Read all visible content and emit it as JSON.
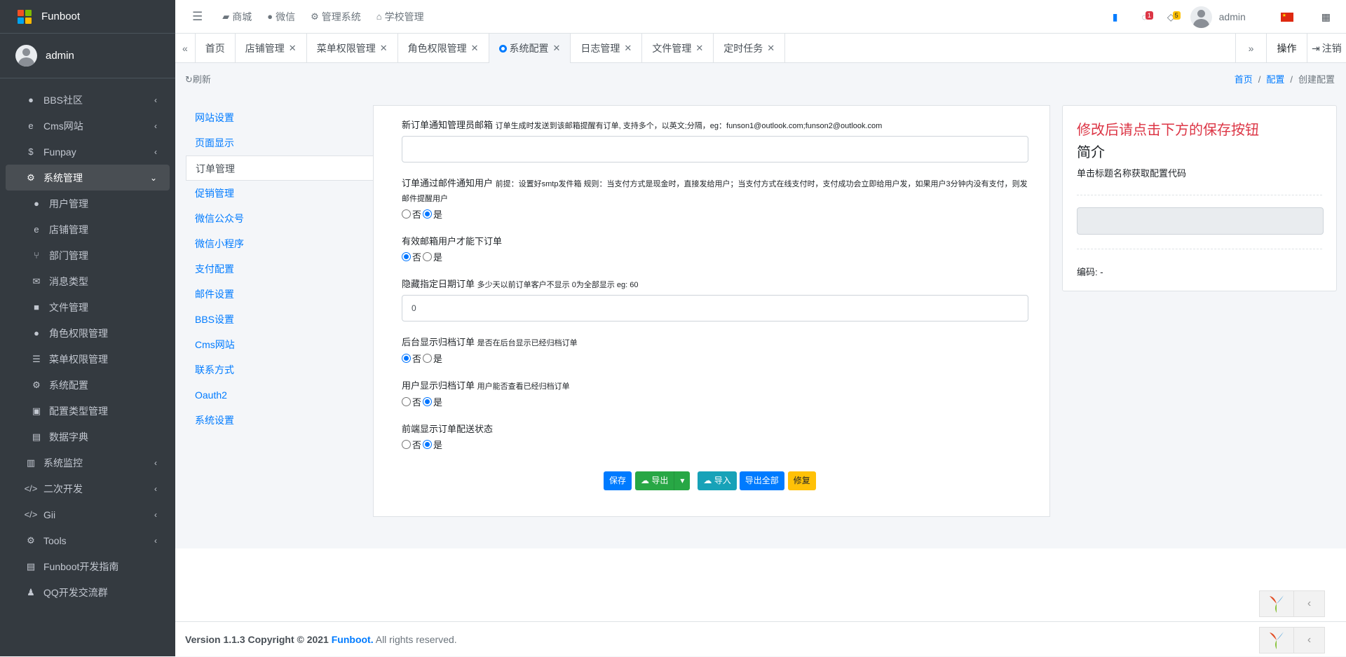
{
  "brand": {
    "name": "Funboot"
  },
  "user": {
    "name": "admin"
  },
  "sidebar": {
    "items": [
      {
        "label": "BBS社区",
        "icon": "comment-icon",
        "chev": "‹"
      },
      {
        "label": "Cms网站",
        "icon": "ie-icon",
        "chev": "‹"
      },
      {
        "label": "Funpay",
        "icon": "dollar-icon",
        "chev": "‹"
      },
      {
        "label": "系统管理",
        "icon": "cogs-icon",
        "chev": "⌄"
      },
      {
        "label": "用户管理",
        "icon": "user-icon"
      },
      {
        "label": "店铺管理",
        "icon": "ie-icon"
      },
      {
        "label": "部门管理",
        "icon": "branch-icon"
      },
      {
        "label": "消息类型",
        "icon": "envelope-icon"
      },
      {
        "label": "文件管理",
        "icon": "folder-icon"
      },
      {
        "label": "角色权限管理",
        "icon": "users-icon"
      },
      {
        "label": "菜单权限管理",
        "icon": "list-icon"
      },
      {
        "label": "系统配置",
        "icon": "cog-icon"
      },
      {
        "label": "配置类型管理",
        "icon": "clipboard-icon"
      },
      {
        "label": "数据字典",
        "icon": "book-icon"
      },
      {
        "label": "系统监控",
        "icon": "chart-icon",
        "chev": "‹"
      },
      {
        "label": "二次开发",
        "icon": "code-icon",
        "chev": "‹"
      },
      {
        "label": "Gii",
        "icon": "code-icon",
        "chev": "‹"
      },
      {
        "label": "Tools",
        "icon": "cogs-icon",
        "chev": "‹"
      },
      {
        "label": "Funboot开发指南",
        "icon": "book-icon"
      },
      {
        "label": "QQ开发交流群",
        "icon": "qq-icon"
      }
    ]
  },
  "topnav": {
    "items": [
      "商城",
      "微信",
      "管理系统",
      "学校管理"
    ],
    "user": "admin",
    "msg_count": "1",
    "notify_count": "5"
  },
  "tabs": {
    "items": [
      "首页",
      "店铺管理",
      "菜单权限管理",
      "角色权限管理",
      "系统配置",
      "日志管理",
      "文件管理",
      "定时任务"
    ],
    "ops": "操作",
    "logout": "注销"
  },
  "header": {
    "refresh": "刷新",
    "crumbs": [
      "首页",
      "配置",
      "创建配置"
    ]
  },
  "leftmenu": {
    "items": [
      "网站设置",
      "页面显示",
      "订单管理",
      "促销管理",
      "微信公众号",
      "微信小程序",
      "支付配置",
      "邮件设置",
      "BBS设置",
      "Cms网站",
      "联系方式",
      "Oauth2",
      "系统设置"
    ]
  },
  "form": {
    "f1": {
      "label": "新订单通知管理员邮箱",
      "hint": "订单生成时发送到该邮箱提醒有订单, 支持多个，以英文;分隔，eg：funson1@outlook.com;funson2@outlook.com",
      "value": ""
    },
    "f2": {
      "label": "订单通过邮件通知用户",
      "hint": "前提：设置好smtp发件箱 规则：当支付方式是现金时，直接发给用户；当支付方式在线支付时，支付成功会立即给用户发，如果用户3分钟内没有支付，则发邮件提醒用户",
      "selected": "是"
    },
    "f3": {
      "label": "有效邮箱用户才能下订单",
      "hint": "",
      "selected": "否"
    },
    "f4": {
      "label": "隐藏指定日期订单",
      "hint": "多少天以前订单客户不显示 0为全部显示 eg: 60",
      "value": "0"
    },
    "f5": {
      "label": "后台显示归档订单",
      "hint": "是否在后台显示已经归档订单",
      "selected": "否"
    },
    "f6": {
      "label": "用户显示归档订单",
      "hint": "用户能否查看已经归档订单",
      "selected": "是"
    },
    "f7": {
      "label": "前端显示订单配送状态",
      "hint": "",
      "selected": "是"
    },
    "no": "否",
    "yes": "是"
  },
  "buttons": {
    "save": "保存",
    "export": "导出",
    "import": "导入",
    "export_all": "导出全部",
    "repair": "修复"
  },
  "side_card": {
    "warn": "修改后请点击下方的保存按钮",
    "title": "简介",
    "hint": "单击标题名称获取配置代码",
    "code": "编码: -"
  },
  "footer": {
    "version": "Version 1.1.3 Copyright © 2021 ",
    "brand": "Funboot.",
    "rights": " All rights reserved."
  },
  "colors": {
    "primary": "#007bff",
    "success": "#28a745",
    "info": "#17a2b8",
    "warning": "#ffc107",
    "danger": "#dc3545",
    "sidebar": "#343a40"
  }
}
